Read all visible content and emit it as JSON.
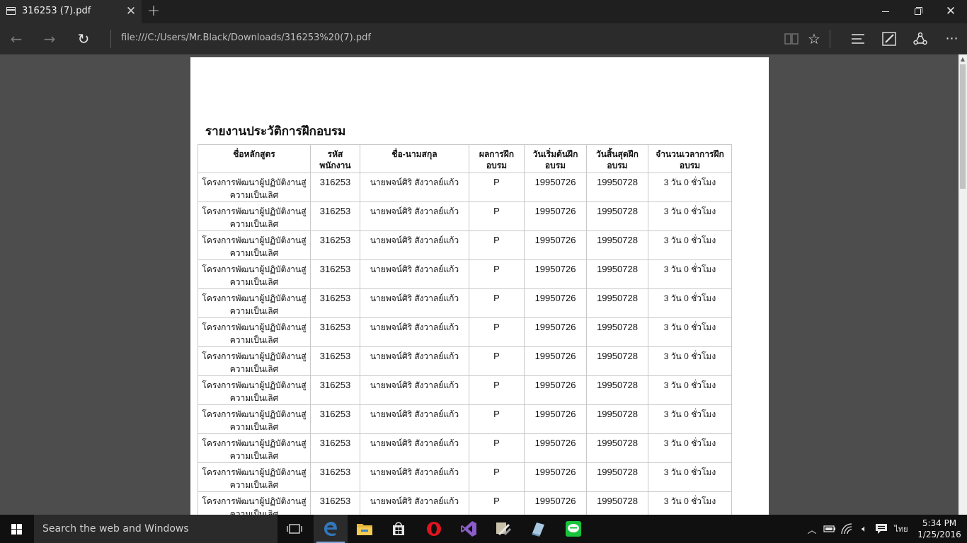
{
  "browser": {
    "tab_title": "316253 (7).pdf",
    "tab_close": "✕",
    "new_tab": "+",
    "address": "file:///C:/Users/Mr.Black/Downloads/316253%20(7).pdf",
    "icons": {
      "back": "arrow-left-icon",
      "forward": "arrow-right-icon",
      "refresh": "refresh-icon",
      "reading_view": "book-icon",
      "favorite": "star-icon",
      "hub": "hub-icon",
      "web_note": "pen-icon",
      "share": "share-icon",
      "more": "more-icon"
    }
  },
  "document": {
    "title": "รายงานประวัติการฝึกอบรม",
    "columns": [
      "ชื่อหลักสูตร",
      "รหัส\nพนักงาน",
      "ชื่อ-นามสกุล",
      "ผลการฝึก\nอบรม",
      "วันเริ่มต้นฝึก\nอบรม",
      "วันสิ้นสุดฝึก\nอบรม",
      "จำนวนเวลาการฝึก\nอบรม"
    ],
    "rows": [
      {
        "course": "โครงการพัฒนาผู้ปฏิบัติงานสู่\nความเป็นเลิศ",
        "emp_id": "316253",
        "name": "นายพจน์ศิริ สังวาลย์แก้ว",
        "result": "P",
        "start": "19950726",
        "end": "19950728",
        "duration": "3 วัน 0 ชั่วโมง"
      },
      {
        "course": "โครงการพัฒนาผู้ปฏิบัติงานสู่\nความเป็นเลิศ",
        "emp_id": "316253",
        "name": "นายพจน์ศิริ สังวาลย์แก้ว",
        "result": "P",
        "start": "19950726",
        "end": "19950728",
        "duration": "3 วัน 0 ชั่วโมง"
      },
      {
        "course": "โครงการพัฒนาผู้ปฏิบัติงานสู่\nความเป็นเลิศ",
        "emp_id": "316253",
        "name": "นายพจน์ศิริ สังวาลย์แก้ว",
        "result": "P",
        "start": "19950726",
        "end": "19950728",
        "duration": "3 วัน 0 ชั่วโมง"
      },
      {
        "course": "โครงการพัฒนาผู้ปฏิบัติงานสู่\nความเป็นเลิศ",
        "emp_id": "316253",
        "name": "นายพจน์ศิริ สังวาลย์แก้ว",
        "result": "P",
        "start": "19950726",
        "end": "19950728",
        "duration": "3 วัน 0 ชั่วโมง"
      },
      {
        "course": "โครงการพัฒนาผู้ปฏิบัติงานสู่\nความเป็นเลิศ",
        "emp_id": "316253",
        "name": "นายพจน์ศิริ สังวาลย์แก้ว",
        "result": "P",
        "start": "19950726",
        "end": "19950728",
        "duration": "3 วัน 0 ชั่วโมง"
      },
      {
        "course": "โครงการพัฒนาผู้ปฏิบัติงานสู่\nความเป็นเลิศ",
        "emp_id": "316253",
        "name": "นายพจน์ศิริ สังวาลย์แก้ว",
        "result": "P",
        "start": "19950726",
        "end": "19950728",
        "duration": "3 วัน 0 ชั่วโมง"
      },
      {
        "course": "โครงการพัฒนาผู้ปฏิบัติงานสู่\nความเป็นเลิศ",
        "emp_id": "316253",
        "name": "นายพจน์ศิริ สังวาลย์แก้ว",
        "result": "P",
        "start": "19950726",
        "end": "19950728",
        "duration": "3 วัน 0 ชั่วโมง"
      },
      {
        "course": "โครงการพัฒนาผู้ปฏิบัติงานสู่\nความเป็นเลิศ",
        "emp_id": "316253",
        "name": "นายพจน์ศิริ สังวาลย์แก้ว",
        "result": "P",
        "start": "19950726",
        "end": "19950728",
        "duration": "3 วัน 0 ชั่วโมง"
      },
      {
        "course": "โครงการพัฒนาผู้ปฏิบัติงานสู่\nความเป็นเลิศ",
        "emp_id": "316253",
        "name": "นายพจน์ศิริ สังวาลย์แก้ว",
        "result": "P",
        "start": "19950726",
        "end": "19950728",
        "duration": "3 วัน 0 ชั่วโมง"
      },
      {
        "course": "โครงการพัฒนาผู้ปฏิบัติงานสู่\nความเป็นเลิศ",
        "emp_id": "316253",
        "name": "นายพจน์ศิริ สังวาลย์แก้ว",
        "result": "P",
        "start": "19950726",
        "end": "19950728",
        "duration": "3 วัน 0 ชั่วโมง"
      },
      {
        "course": "โครงการพัฒนาผู้ปฏิบัติงานสู่\nความเป็นเลิศ",
        "emp_id": "316253",
        "name": "นายพจน์ศิริ สังวาลย์แก้ว",
        "result": "P",
        "start": "19950726",
        "end": "19950728",
        "duration": "3 วัน 0 ชั่วโมง"
      },
      {
        "course": "โครงการพัฒนาผู้ปฏิบัติงานสู่\nความเป็นเลิศ",
        "emp_id": "316253",
        "name": "นายพจน์ศิริ สังวาลย์แก้ว",
        "result": "P",
        "start": "19950726",
        "end": "19950728",
        "duration": "3 วัน 0 ชั่วโมง"
      }
    ]
  },
  "taskbar": {
    "search_placeholder": "Search the web and Windows",
    "apps": [
      "task-view-icon",
      "edge-icon",
      "file-explorer-icon",
      "store-icon",
      "opera-icon",
      "visual-studio-icon",
      "tools-icon",
      "app-icon",
      "line-icon"
    ],
    "language": "ไทย",
    "time": "5:34 PM",
    "date": "1/25/2016",
    "accent_color": "#7fa7d6"
  }
}
